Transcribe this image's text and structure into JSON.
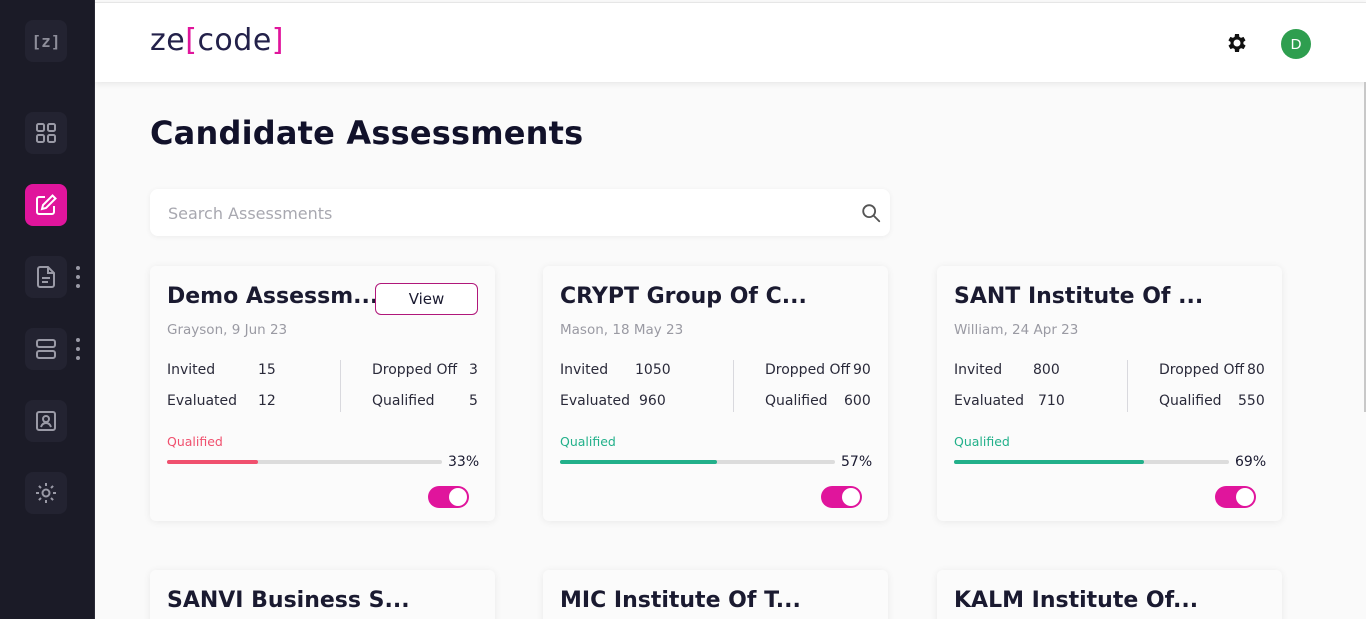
{
  "app": {
    "logo_prefix": "ze",
    "logo_open": "[",
    "logo_word": "code",
    "logo_close": "]",
    "avatar_initial": "D",
    "sidebar_logo": "[z]"
  },
  "colors": {
    "accent": "#e0159c",
    "sidebar_bg": "#1b1b27",
    "qualified_low": "#f0506e",
    "qualified_ok": "#22b08a",
    "avatar": "#2e9e4f"
  },
  "page": {
    "title": "Candidate Assessments"
  },
  "search": {
    "placeholder": "Search Assessments"
  },
  "cards": [
    {
      "title": "Demo Assessm...",
      "view_label": "View",
      "meta": "Grayson, 9 Jun 23",
      "invited_label": "Invited",
      "invited": "15",
      "evaluated_label": "Evaluated",
      "evaluated": "12",
      "dropped_label": "Dropped Off",
      "dropped": "3",
      "qualified_label": "Qualified",
      "qualified": "5",
      "bar_label": "Qualified",
      "percent": "33%",
      "progress": 0.33,
      "status": "low"
    },
    {
      "title": "CRYPT Group Of C...",
      "meta": "Mason, 18 May 23",
      "invited_label": "Invited",
      "invited": "1050",
      "evaluated_label": "Evaluated",
      "evaluated": "960",
      "dropped_label": "Dropped Off",
      "dropped": "90",
      "qualified_label": "Qualified",
      "qualified": "600",
      "bar_label": "Qualified",
      "percent": "57%",
      "progress": 0.57,
      "status": "ok"
    },
    {
      "title": "SANT Institute Of ...",
      "meta": "William, 24 Apr 23",
      "invited_label": "Invited",
      "invited": "800",
      "evaluated_label": "Evaluated",
      "evaluated": "710",
      "dropped_label": "Dropped Off",
      "dropped": "80",
      "qualified_label": "Qualified",
      "qualified": "550",
      "bar_label": "Qualified",
      "percent": "69%",
      "progress": 0.69,
      "status": "ok"
    }
  ],
  "cards_partial": [
    {
      "title": "SANVI Business S..."
    },
    {
      "title": "MIC Institute Of T..."
    },
    {
      "title": "KALM Institute Of..."
    }
  ],
  "icons": {
    "sidebar": [
      "grid-icon",
      "edit-icon",
      "document-icon",
      "server-icon",
      "id-card-icon",
      "settings-icon"
    ],
    "header": [
      "gear-icon",
      "avatar"
    ],
    "search": "search-icon"
  }
}
